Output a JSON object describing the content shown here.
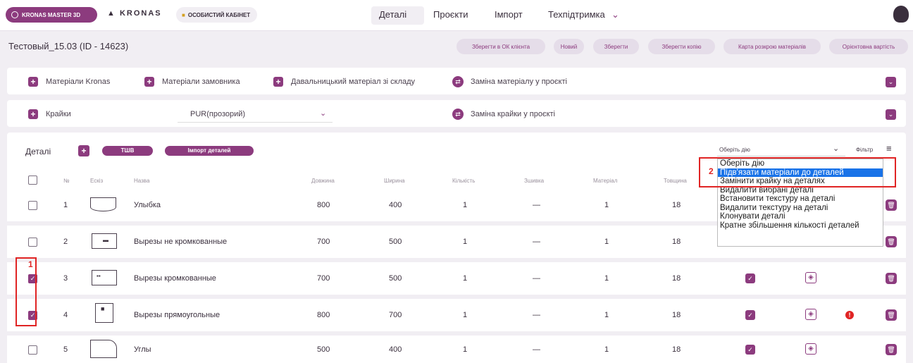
{
  "topbar": {
    "brand": "KRONAS MASTER 3D",
    "logo": "KRONAS",
    "cabinet": "ОСОБИСТИЙ КАБІНЕТ",
    "nav": [
      "Деталі",
      "Проєкти",
      "Імпорт",
      "Техпідтримка"
    ],
    "active_nav": "Деталі",
    "nav_chevron": "⌄",
    "icons": [
      "globe-icon",
      "house-icon",
      "person-icon",
      "user-avatar-icon"
    ]
  },
  "project": {
    "title": "Тестовый_15.03  (ID - 14623)",
    "actions": [
      "Зберегти в ОК клієнта",
      "Новий",
      "Зберегти",
      "Зберегти копію",
      "Карта розкрою матеріалів",
      "Орієнтовна вартість"
    ]
  },
  "materials_bar": {
    "items": [
      "Матеріали Kronas",
      "Матеріали замовника",
      "Давальницький матеріал зі складу"
    ],
    "replace": "Заміна матеріалу у проєкті"
  },
  "edges_bar": {
    "label": "Крайки",
    "select_value": "PUR(прозорий)",
    "replace": "Заміна крайки у проєкті"
  },
  "details": {
    "title": "Деталі",
    "tsb": "ТШВ",
    "import": "Імпорт деталей",
    "action_select": "Оберіть дію",
    "filter": "Фільтр",
    "columns": [
      "№",
      "Ескіз",
      "Назва",
      "Довжина",
      "Ширина",
      "Кількість",
      "Зшивка",
      "Матеріал",
      "Товщина"
    ],
    "rows": [
      {
        "n": "1",
        "name": "Улыбка",
        "length": "800",
        "width": "400",
        "qty": "1",
        "sewing": "—",
        "material": "1",
        "thickness": "18",
        "checked": false
      },
      {
        "n": "2",
        "name": "Вырезы не кромкованные",
        "length": "700",
        "width": "500",
        "qty": "1",
        "sewing": "—",
        "material": "1",
        "thickness": "18",
        "checked": false
      },
      {
        "n": "3",
        "name": "Вырезы кромкованные",
        "length": "700",
        "width": "500",
        "qty": "1",
        "sewing": "—",
        "material": "1",
        "thickness": "18",
        "checked": true
      },
      {
        "n": "4",
        "name": "Вырезы прямоугольные",
        "length": "800",
        "width": "700",
        "qty": "1",
        "sewing": "—",
        "material": "1",
        "thickness": "18",
        "checked": true
      },
      {
        "n": "5",
        "name": "Углы",
        "length": "500",
        "width": "400",
        "qty": "1",
        "sewing": "—",
        "material": "1",
        "thickness": "18",
        "checked": false
      }
    ]
  },
  "dropdown": {
    "options": [
      "Оберіть дію",
      "Підв'язати матеріали до деталей",
      "Замінити крайку на деталях",
      "Видалити вибрані деталі",
      "Встановити текстуру на деталі",
      "Видалити текстуру на деталі",
      "Клонувати деталі",
      "Кратне збільшення кількості деталей"
    ],
    "selected_index": 1
  },
  "annotations": {
    "marker1": "1",
    "marker2": "2",
    "color": "#e02424"
  },
  "colors": {
    "accent": "#8c3b7e",
    "background": "#f1eef3",
    "selected_option": "#1a73e8"
  }
}
